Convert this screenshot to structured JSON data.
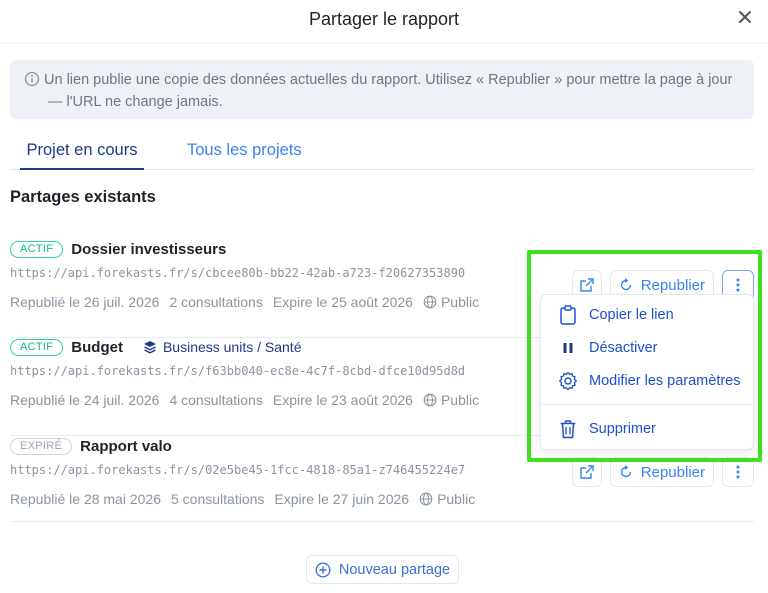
{
  "dialog": {
    "title": "Partager le rapport"
  },
  "info": {
    "line1": "Un lien publie une copie des données actuelles du rapport. Utilisez « Republier » pour mettre la page à jour",
    "line2": "— l'URL ne change jamais."
  },
  "tabs": [
    {
      "label": "Projet en cours",
      "active": true
    },
    {
      "label": "Tous les projets",
      "active": false
    }
  ],
  "section_title": "Partages existants",
  "shares": [
    {
      "status": "ACTIF",
      "name": "Dossier investisseurs",
      "tag": "",
      "url": "https://api.forekasts.fr/s/cbcee80b-bb22-42ab-a723-f20627353890",
      "published": "Republié le 26 juil. 2026",
      "views": "2 consultations",
      "expires": "Expire le 25 août 2026",
      "visibility": "Public"
    },
    {
      "status": "ACTIF",
      "name": "Budget",
      "tag": "Business units / Santé",
      "url": "https://api.forekasts.fr/s/f63bb040-ec8e-4c7f-8cbd-dfce10d95d8d",
      "published": "Republié le 24 juil. 2026",
      "views": "4 consultations",
      "expires": "Expire le 23 août 2026",
      "visibility": "Public"
    },
    {
      "status": "EXPIRÉ",
      "name": "Rapport valo",
      "tag": "",
      "url": "https://api.forekasts.fr/s/02e5be45-1fcc-4818-85a1-z746455224e7",
      "published": "Republié le 28 mai 2026",
      "views": "5 consultations",
      "expires": "Expire le 27 juin 2026",
      "visibility": "Public"
    }
  ],
  "actions": {
    "republish_label": "Republier"
  },
  "menu": {
    "items": [
      {
        "label": "Copier le lien",
        "icon": "clipboard-icon"
      },
      {
        "label": "Désactiver",
        "icon": "pause-icon"
      },
      {
        "label": "Modifier les paramètres",
        "icon": "gear-icon"
      },
      {
        "label": "Supprimer",
        "icon": "trash-icon"
      }
    ]
  },
  "new_share_label": "Nouveau partage",
  "colors": {
    "accent": "#3b82f6",
    "accent_dark": "#1e3a8a",
    "active_badge": "#10b981",
    "highlight": "#3ce01e"
  }
}
